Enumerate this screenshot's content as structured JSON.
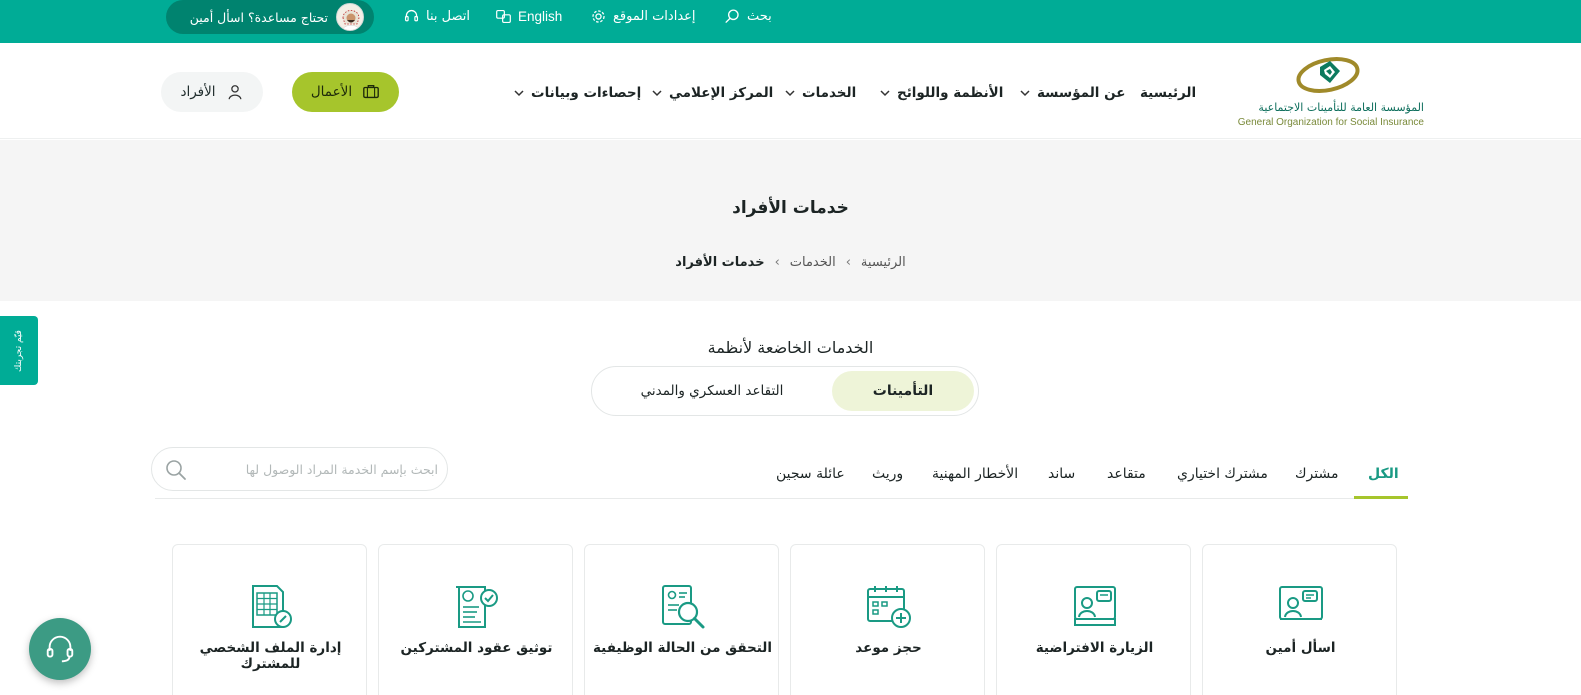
{
  "topbar": {
    "search": "بحث",
    "site_settings": "إعدادات الموقع",
    "language": "English",
    "contact": "اتصل بنا",
    "help": "تحتاج مساعدة؟ اسأل أمين"
  },
  "header": {
    "logo_ar": "المؤسسة العامة للتأمينات الاجتماعية",
    "logo_en": "General Organization for Social Insurance",
    "nav": {
      "home": "الرئيسية",
      "about": "عن المؤسسة",
      "regulations": "الأنظمة واللوائح",
      "services": "الخدمات",
      "media": "المركز الإعلامي",
      "statistics": "إحصاءات وبيانات"
    },
    "business_btn": "الأعمال",
    "individuals_btn": "الأفراد"
  },
  "hero": {
    "title": "خدمات الأفراد",
    "breadcrumb": {
      "home": "الرئيسية",
      "services": "الخدمات",
      "current": "خدمات الأفراد"
    }
  },
  "side_tab": "قيّم تجربتك",
  "section": {
    "title": "الخدمات الخاضعة لأنظمة",
    "toggle_active": "التأمينات",
    "toggle_other": "التقاعد العسكري والمدني"
  },
  "filters": {
    "all": "الكل",
    "subscriber": "مشترك",
    "optional": "مشترك اختياري",
    "retiree": "متقاعد",
    "saned": "ساند",
    "hazards": "الأخطار المهنية",
    "heir": "وريث",
    "prisoner_family": "عائلة سجين"
  },
  "search": {
    "placeholder": "ابحث بإسم الخدمة المراد الوصول لها"
  },
  "cards": [
    {
      "label": "اسأل أمين",
      "icon": "chat-agent-icon"
    },
    {
      "label": "الزيارة الافتراضية",
      "icon": "virtual-visit-icon"
    },
    {
      "label": "حجز موعد",
      "icon": "calendar-add-icon"
    },
    {
      "label": "التحقق من الحالة الوظيفية",
      "icon": "document-search-icon"
    },
    {
      "label": "توثيق عقود المشتركين",
      "icon": "contract-verify-icon"
    },
    {
      "label": "إدارة الملف الشخصي للمشترك",
      "icon": "profile-file-edit-icon"
    }
  ],
  "colors": {
    "primary": "#00ac96",
    "accent": "#a6c52c"
  }
}
